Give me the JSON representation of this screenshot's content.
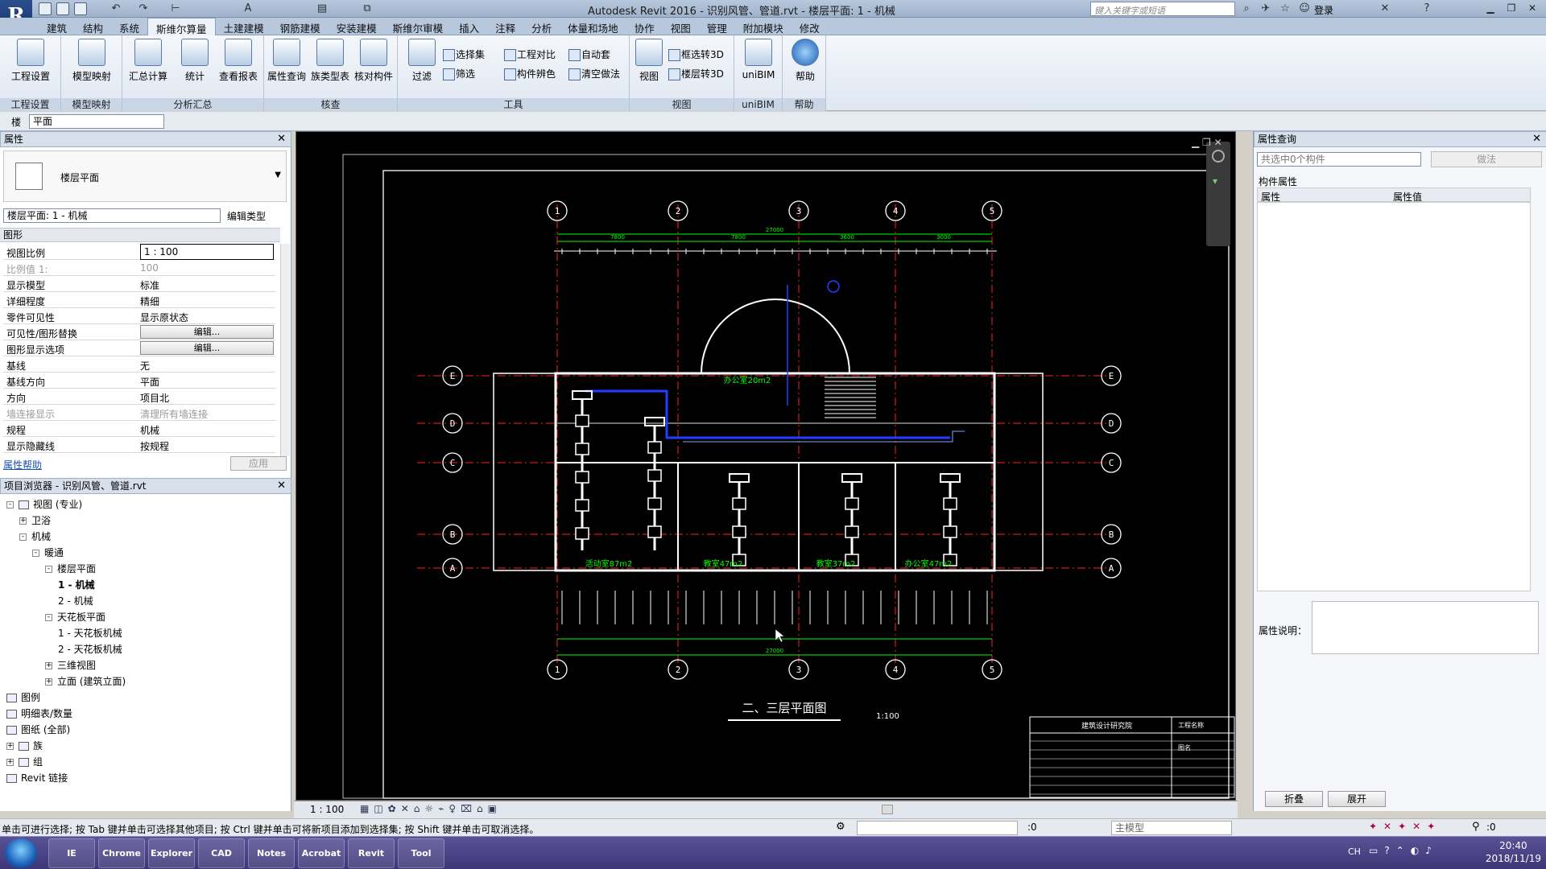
{
  "window": {
    "title": "Autodesk Revit 2016 -    识别风管、管道.rvt - 楼层平面: 1 - 机械",
    "search_placeholder": "键入关键字或短语",
    "login": "登录",
    "app_letter": "R"
  },
  "tabs": [
    "建筑",
    "结构",
    "系统",
    "斯维尔算量",
    "土建建模",
    "钢筋建模",
    "安装建模",
    "斯维尔审模",
    "插入",
    "注释",
    "分析",
    "体量和场地",
    "协作",
    "视图",
    "管理",
    "附加模块",
    "修改"
  ],
  "active_tab": "斯维尔算量",
  "ribbon": {
    "buttons": [
      {
        "name": "project-settings-button",
        "label": "工程设置"
      },
      {
        "name": "model-mapping-button",
        "label": "模型映射"
      },
      {
        "name": "summary-calc-button",
        "label": "汇总计算"
      },
      {
        "name": "statistics-button",
        "label": "统计"
      },
      {
        "name": "view-report-button",
        "label": "查看报表"
      },
      {
        "name": "property-query-button",
        "label": "属性查询"
      },
      {
        "name": "family-type-table-button",
        "label": "族类型表"
      },
      {
        "name": "check-component-button",
        "label": "核对构件"
      },
      {
        "name": "filter-button",
        "label": "过滤"
      },
      {
        "name": "view-button",
        "label": "视图"
      },
      {
        "name": "unibim-button",
        "label": "uniBIM"
      },
      {
        "name": "help-button",
        "label": "帮助"
      }
    ],
    "small": [
      {
        "name": "selection-set-button",
        "label": "选择集"
      },
      {
        "name": "filter-small-button",
        "label": "筛选"
      },
      {
        "name": "project-compare-button",
        "label": "工程对比"
      },
      {
        "name": "component-color-button",
        "label": "构件辨色"
      },
      {
        "name": "auto-set-button",
        "label": "自动套"
      },
      {
        "name": "clear-method-button",
        "label": "清空做法"
      },
      {
        "name": "frame-to-3d-button",
        "label": "框选转3D"
      },
      {
        "name": "floor-to-3d-button",
        "label": "楼层转3D"
      }
    ],
    "groups": [
      "工程设置",
      "模型映射",
      "分析汇总",
      "核查",
      "工具",
      "视图",
      "uniBIM",
      "帮助"
    ]
  },
  "options_bar": {
    "prefix": "楼",
    "plan_select": "平面"
  },
  "properties": {
    "title": "属性",
    "type_name": "楼层平面",
    "instance_select": "楼层平面: 1 - 机械",
    "edit_type": "编辑类型",
    "section": "图形",
    "rows": [
      {
        "k": "视图比例",
        "v": "1 : 100",
        "kind": "box"
      },
      {
        "k": "比例值 1:",
        "v": "100",
        "kind": "dim"
      },
      {
        "k": "显示模型",
        "v": "标准",
        "kind": "text"
      },
      {
        "k": "详细程度",
        "v": "精细",
        "kind": "text"
      },
      {
        "k": "零件可见性",
        "v": "显示原状态",
        "kind": "text"
      },
      {
        "k": "可见性/图形替换",
        "v": "编辑...",
        "kind": "btn"
      },
      {
        "k": "图形显示选项",
        "v": "编辑...",
        "kind": "btn"
      },
      {
        "k": "基线",
        "v": "无",
        "kind": "text"
      },
      {
        "k": "基线方向",
        "v": "平面",
        "kind": "text"
      },
      {
        "k": "方向",
        "v": "项目北",
        "kind": "text"
      },
      {
        "k": "墙连接显示",
        "v": "清理所有墙连接",
        "kind": "dim"
      },
      {
        "k": "规程",
        "v": "机械",
        "kind": "text"
      },
      {
        "k": "显示隐藏线",
        "v": "按规程",
        "kind": "text"
      }
    ],
    "help_link": "属性帮助",
    "apply": "应用"
  },
  "browser": {
    "title": "项目浏览器 - 识别风管、管道.rvt",
    "nodes": [
      {
        "t": "视图 (专业)",
        "lvl": 0,
        "g": "-",
        "name": "tree-views"
      },
      {
        "t": "卫浴",
        "lvl": 1,
        "g": "+",
        "name": "tree-plumbing"
      },
      {
        "t": "机械",
        "lvl": 1,
        "g": "-",
        "name": "tree-mechanical"
      },
      {
        "t": "暖通",
        "lvl": 2,
        "g": "-",
        "name": "tree-hvac"
      },
      {
        "t": "楼层平面",
        "lvl": 3,
        "g": "-",
        "name": "tree-floor-plans"
      },
      {
        "t": "1 - 机械",
        "lvl": 4,
        "g": "",
        "name": "tree-plan-1",
        "sel": true
      },
      {
        "t": "2 - 机械",
        "lvl": 4,
        "g": "",
        "name": "tree-plan-2"
      },
      {
        "t": "天花板平面",
        "lvl": 3,
        "g": "-",
        "name": "tree-ceiling-plans"
      },
      {
        "t": "1 - 天花板机械",
        "lvl": 4,
        "g": "",
        "name": "tree-ceiling-1"
      },
      {
        "t": "2 - 天花板机械",
        "lvl": 4,
        "g": "",
        "name": "tree-ceiling-2"
      },
      {
        "t": "三维视图",
        "lvl": 3,
        "g": "+",
        "name": "tree-3d-views"
      },
      {
        "t": "立面 (建筑立面)",
        "lvl": 3,
        "g": "+",
        "name": "tree-elevations"
      },
      {
        "t": "图例",
        "lvl": 0,
        "g": "",
        "name": "tree-legends"
      },
      {
        "t": "明细表/数量",
        "lvl": 0,
        "g": "",
        "name": "tree-schedules"
      },
      {
        "t": "图纸 (全部)",
        "lvl": 0,
        "g": "",
        "name": "tree-sheets"
      },
      {
        "t": "族",
        "lvl": 0,
        "g": "+",
        "name": "tree-families"
      },
      {
        "t": "组",
        "lvl": 0,
        "g": "+",
        "name": "tree-groups"
      },
      {
        "t": "Revit 链接",
        "lvl": 0,
        "g": "",
        "name": "tree-revit-links"
      }
    ]
  },
  "drawing": {
    "title": "二、三层平面图",
    "scale": "1:100",
    "col_labels": [
      "1",
      "2",
      "3",
      "4",
      "5"
    ],
    "row_labels": [
      "E",
      "D",
      "C",
      "B",
      "A"
    ],
    "top_dims": [
      "7800",
      "7800",
      "3600",
      "3000"
    ],
    "total_dim": "27000",
    "room_labels": [
      "办公室20m2",
      "活动室87m2",
      "教室47m2",
      "教室37m2",
      "办公室47m2"
    ],
    "titleblock": {
      "org": "建筑设计研究院",
      "project": "工程名称",
      "drawing": "图名"
    }
  },
  "view_controls": {
    "scale": "1 : 100"
  },
  "query_panel": {
    "title": "属性查询",
    "select": "共选中0个构件",
    "method_btn": "做法",
    "section": "构件属性",
    "col_prop": "属性",
    "col_value": "属性值",
    "desc_label": "属性说明：",
    "collapse": "折叠",
    "expand": "展开"
  },
  "status": {
    "hint": "单击可进行选择; 按 Tab 键并单击可选择其他项目; 按 Ctrl 键并单击可将新项目添加到选择集; 按 Shift 键并单击可取消选择。",
    "count": ":0",
    "model": "主模型",
    "filter_count": ":0"
  },
  "taskbar": {
    "apps": [
      "IE",
      "Chrome",
      "Explorer",
      "CAD",
      "Notes",
      "Acrobat",
      "Revit",
      "Tool"
    ],
    "lang": "CH",
    "time": "20:40",
    "date": "2018/11/19"
  },
  "colors": {
    "accent": "#2b4f8f",
    "canvas": "#000000",
    "cad_white": "#ffffff",
    "cad_green": "#00ff00",
    "cad_red": "#ff2020",
    "cad_blue": "#2040ff"
  }
}
